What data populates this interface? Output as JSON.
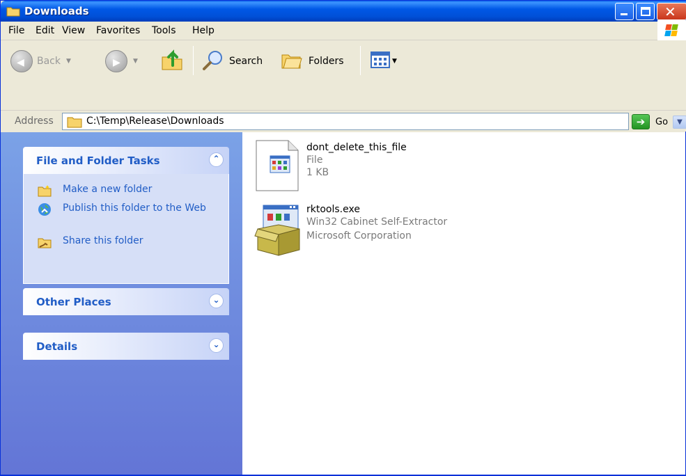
{
  "window": {
    "title": "Downloads"
  },
  "menu": {
    "file": "File",
    "edit": "Edit",
    "view": "View",
    "favorites": "Favorites",
    "tools": "Tools",
    "help": "Help"
  },
  "toolbar": {
    "back_label": "Back",
    "search_label": "Search",
    "folders_label": "Folders"
  },
  "address": {
    "label": "Address",
    "path": "C:\\Temp\\Release\\Downloads",
    "go_label": "Go"
  },
  "taskpane": {
    "file_folder_tasks": {
      "title": "File and Folder Tasks",
      "tasks": [
        {
          "label": "Make a new folder"
        },
        {
          "label": "Publish this folder to the Web"
        },
        {
          "label": "Share this folder"
        }
      ]
    },
    "other_places": {
      "title": "Other Places"
    },
    "details": {
      "title": "Details"
    }
  },
  "files": [
    {
      "name": "dont_delete_this_file",
      "line2": "File",
      "line3": "1 KB",
      "icon": "generic-file-icon"
    },
    {
      "name": "rktools.exe",
      "line2": "Win32 Cabinet Self-Extractor",
      "line3": "Microsoft Corporation",
      "icon": "installer-box-icon"
    }
  ],
  "colors": {
    "titlebar": "#0058e6",
    "taskpane_link": "#215dc6",
    "taskpane_bg": "#7ba2e7"
  }
}
